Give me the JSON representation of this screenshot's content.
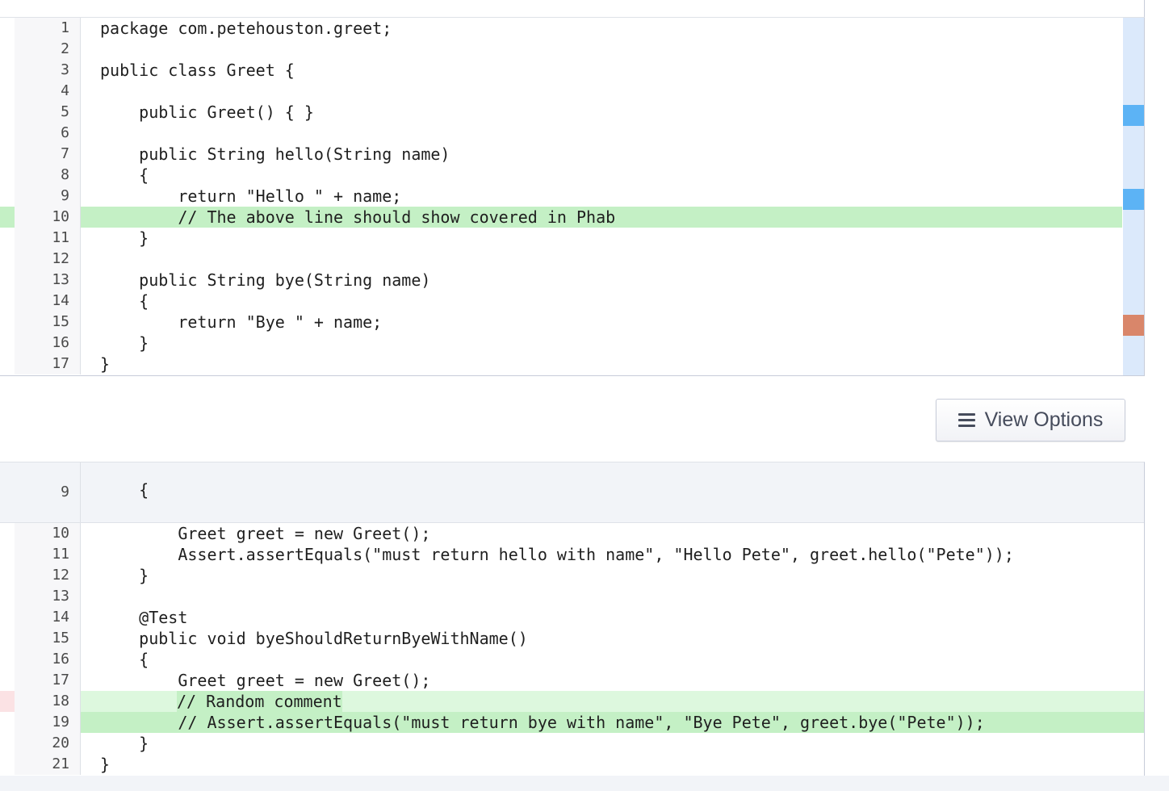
{
  "file1": {
    "lines": [
      {
        "n": "1",
        "code": "package com.petehouston.greet;"
      },
      {
        "n": "2",
        "code": ""
      },
      {
        "n": "3",
        "code": "public class Greet {"
      },
      {
        "n": "4",
        "code": ""
      },
      {
        "n": "5",
        "code": "    public Greet() { }"
      },
      {
        "n": "6",
        "code": ""
      },
      {
        "n": "7",
        "code": "    public String hello(String name)"
      },
      {
        "n": "8",
        "code": "    {"
      },
      {
        "n": "9",
        "code": "        return \"Hello \" + name;"
      },
      {
        "n": "10",
        "code": "        // The above line should show covered in Phab"
      },
      {
        "n": "11",
        "code": "    }"
      },
      {
        "n": "12",
        "code": ""
      },
      {
        "n": "13",
        "code": "    public String bye(String name)"
      },
      {
        "n": "14",
        "code": "    {"
      },
      {
        "n": "15",
        "code": "        return \"Bye \" + name;"
      },
      {
        "n": "16",
        "code": "    }"
      },
      {
        "n": "17",
        "code": "}"
      }
    ],
    "highlighted_line": "10",
    "coverage": [
      {
        "line": "5",
        "status": "covered",
        "color": "#5cb3f5"
      },
      {
        "line": "9",
        "status": "covered",
        "color": "#5cb3f5"
      },
      {
        "line": "15",
        "status": "not-covered",
        "color": "#d9866a"
      }
    ]
  },
  "view_options": {
    "label": "View Options",
    "icon": "hamburger-menu-icon"
  },
  "file2": {
    "context": {
      "n": "9",
      "code": "    {"
    },
    "lines": [
      {
        "n": "10",
        "code": "        Greet greet = new Greet();"
      },
      {
        "n": "11",
        "code": "        Assert.assertEquals(\"must return hello with name\", \"Hello Pete\", greet.hello(\"Pete\"));"
      },
      {
        "n": "12",
        "code": "    }"
      },
      {
        "n": "13",
        "code": ""
      },
      {
        "n": "14",
        "code": "    @Test"
      },
      {
        "n": "15",
        "code": "    public void byeShouldReturnByeWithName()"
      },
      {
        "n": "16",
        "code": "    {"
      },
      {
        "n": "17",
        "code": "        Greet greet = new Greet();"
      },
      {
        "n": "18",
        "code": "        // Random comment"
      },
      {
        "n": "19",
        "code": "        // Assert.assertEquals(\"must return bye with name\", \"Bye Pete\", greet.bye(\"Pete\"));"
      },
      {
        "n": "20",
        "code": "    }"
      },
      {
        "n": "21",
        "code": "}"
      }
    ],
    "changed_light": "18",
    "changed_green": "19"
  },
  "colors": {
    "added_green": "#c4f0c5",
    "added_light": "#ddf8de",
    "coverage_bar": "#dbe9fb",
    "removed_marker": "#fbe2e4"
  }
}
